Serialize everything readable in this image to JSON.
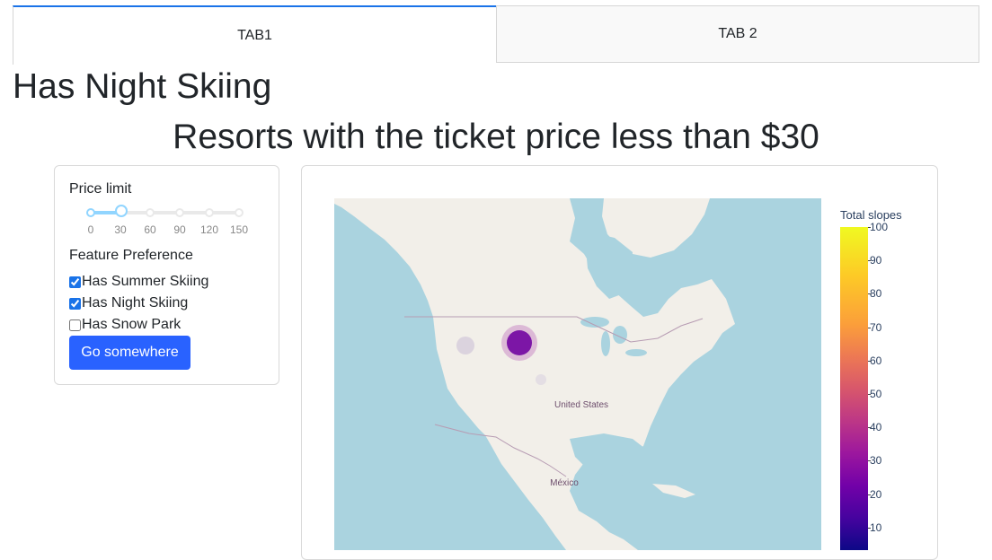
{
  "tabs": [
    {
      "label": "TAB1",
      "active": true
    },
    {
      "label": "TAB 2",
      "active": false
    }
  ],
  "page_title": "Has Night Skiing",
  "subtitle": "Resorts with the ticket price less than $30",
  "controls": {
    "price_label": "Price limit",
    "slider": {
      "value": 30,
      "marks": [
        "0",
        "30",
        "60",
        "90",
        "120",
        "150"
      ]
    },
    "feature_label": "Feature Preference",
    "checkboxes": [
      {
        "label": "Has Summer Skiing",
        "checked": true
      },
      {
        "label": "Has Night Skiing",
        "checked": true
      },
      {
        "label": "Has Snow Park",
        "checked": false
      }
    ],
    "button_label": "Go somewhere"
  },
  "map": {
    "labels": {
      "us": "United States",
      "mexico": "México"
    },
    "colorbar": {
      "title": "Total slopes",
      "ticks": [
        "100",
        "90",
        "80",
        "70",
        "60",
        "50",
        "40",
        "30",
        "20",
        "10"
      ]
    }
  },
  "colors": {
    "accent": "#2962ff",
    "slider": "#91d5ff",
    "water": "#aad3df",
    "land": "#f2efe9"
  }
}
